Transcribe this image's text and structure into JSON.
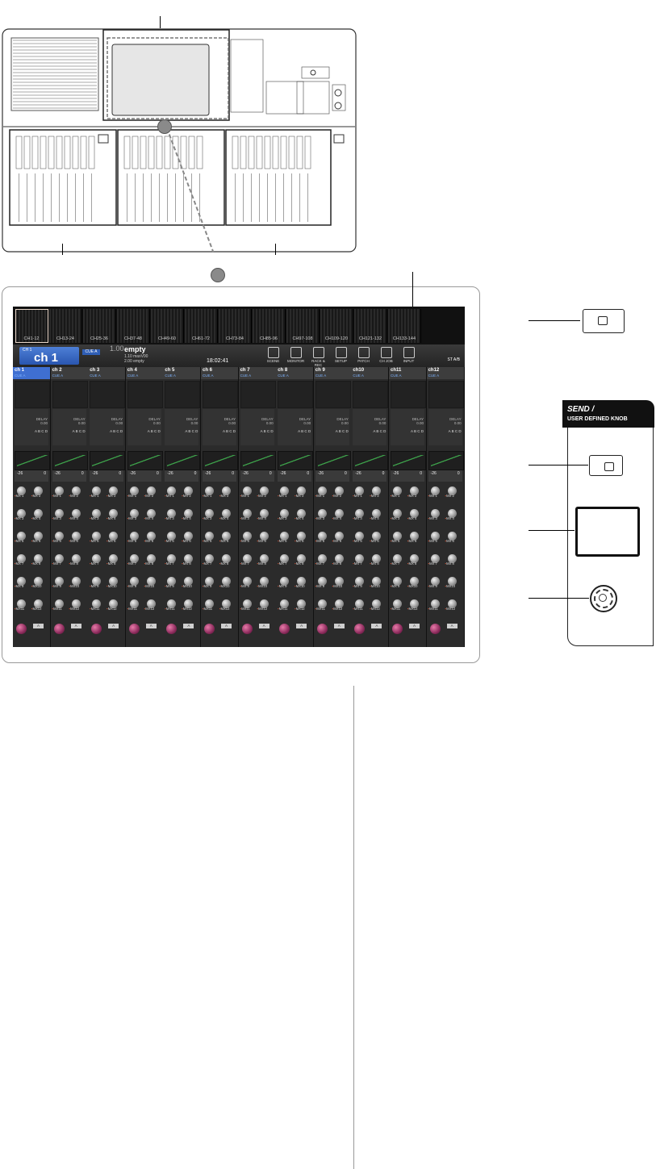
{
  "nav_tabs": [
    "CH1-12",
    "CH13-24",
    "CH25-36",
    "CH37-48",
    "CH49-60",
    "CH61-72",
    "CH73-84",
    "CH85-96",
    "CH97-108",
    "CH109-120",
    "CH121-132",
    "CH133-144"
  ],
  "st_aib": "ST A/B",
  "selected_channel": {
    "label": "CH 1",
    "name": "ch 1",
    "cue": "CUE A"
  },
  "scene": {
    "number": "1.00",
    "title": "empty",
    "line2": "1.10   maxV00",
    "line3": "2.00   empty"
  },
  "clock": "18:02:41",
  "menu_buttons": [
    "SCENE",
    "MONITOR",
    "RACK & REC",
    "SETUP",
    "PATCH",
    "CH JOB",
    "INPUT"
  ],
  "strips": [
    {
      "name": "ch 1",
      "cue": "CUE A",
      "fader_id": "CH 1A",
      "fader_name": "ch 1"
    },
    {
      "name": "ch 2",
      "cue": "CUE A",
      "fader_id": "CH 2A",
      "fader_name": "ch 2"
    },
    {
      "name": "ch 3",
      "cue": "CUE A",
      "fader_id": "CH 3A",
      "fader_name": "ch 3"
    },
    {
      "name": "ch 4",
      "cue": "CUE A",
      "fader_id": "CH 4A",
      "fader_name": "ch 4"
    },
    {
      "name": "ch 5",
      "cue": "CUE A",
      "fader_id": "CH 5A",
      "fader_name": "ch 5"
    },
    {
      "name": "ch 6",
      "cue": "CUE A",
      "fader_id": "CH 6A",
      "fader_name": "ch 6"
    },
    {
      "name": "ch 7",
      "cue": "CUE A",
      "fader_id": "CH 7A",
      "fader_name": "ch 7"
    },
    {
      "name": "ch 8",
      "cue": "CUE A",
      "fader_id": "CH 8A",
      "fader_name": "ch 8"
    },
    {
      "name": "ch 9",
      "cue": "CUE A",
      "fader_id": "CH 9A",
      "fader_name": "ch 9"
    },
    {
      "name": "ch10",
      "cue": "CUE A",
      "fader_id": "CH 10A",
      "fader_name": "ch10"
    },
    {
      "name": "ch11",
      "cue": "CUE A",
      "fader_id": "CH 11A",
      "fader_name": "ch11"
    },
    {
      "name": "ch12",
      "cue": "CUE A",
      "fader_id": "CH 12A",
      "fader_name": "ch12"
    }
  ],
  "strip_static": {
    "delay_label": "DELAY",
    "delay_value": "0.00",
    "abcd": "A B C D",
    "level_a": "-26",
    "level_b": "0",
    "pan_label": "A"
  },
  "mix_labels": [
    "MX 1",
    "MX 2",
    "MX 3",
    "MX 4",
    "MX 5",
    "MX 6",
    "MX 7",
    "MX 8",
    "MX 9",
    "MX10",
    "MX11",
    "MX12"
  ],
  "send_panel": {
    "title": "SEND /",
    "subtitle": "USER DEFINED KNOB"
  }
}
